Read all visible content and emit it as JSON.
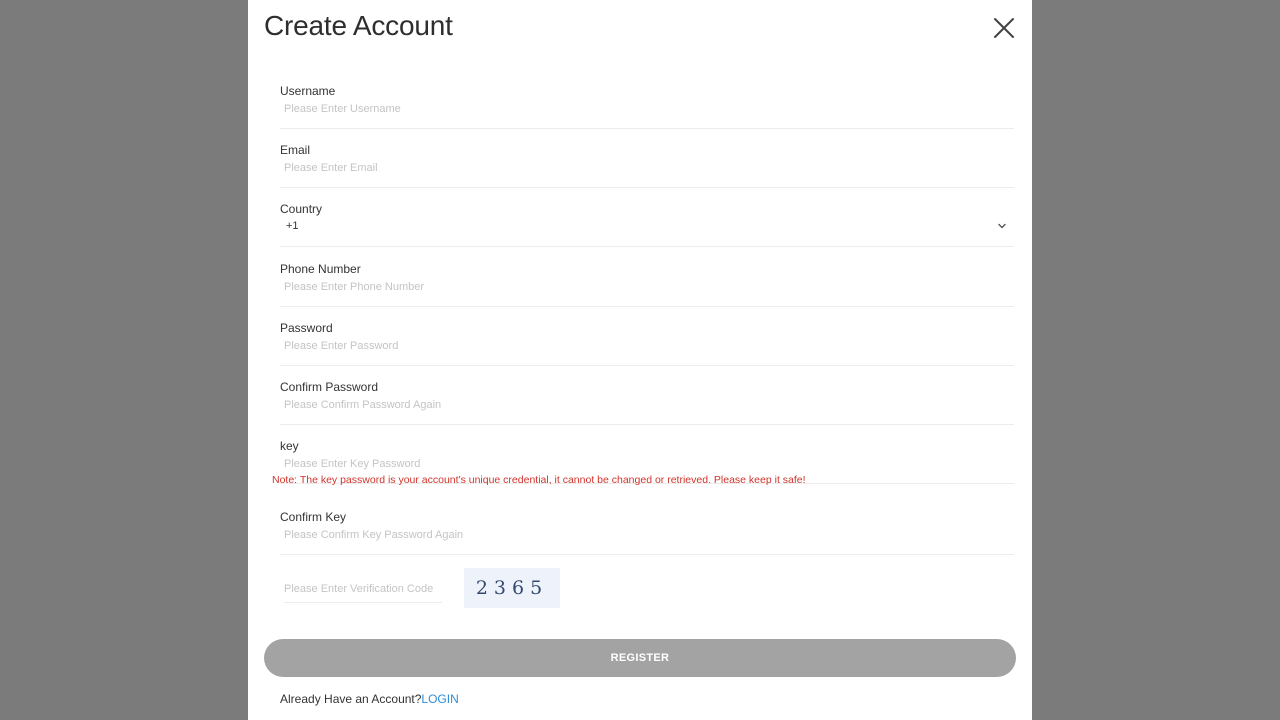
{
  "modal": {
    "title": "Create Account"
  },
  "fields": {
    "username": {
      "label": "Username",
      "placeholder": "Please Enter Username"
    },
    "email": {
      "label": "Email",
      "placeholder": "Please Enter Email"
    },
    "country": {
      "label": "Country",
      "value": "+1"
    },
    "phone": {
      "label": "Phone Number",
      "placeholder": "Please Enter Phone Number"
    },
    "password": {
      "label": "Password",
      "placeholder": "Please Enter Password"
    },
    "confirm_password": {
      "label": "Confirm Password",
      "placeholder": "Please Confirm Password Again"
    },
    "key": {
      "label": "key",
      "placeholder": "Please Enter Key Password"
    },
    "confirm_key": {
      "label": "Confirm Key",
      "placeholder": "Please Confirm Key Password Again"
    }
  },
  "note": "Note: The key password is your account's unique credential, it cannot be changed or retrieved. Please keep it safe!",
  "verification": {
    "placeholder": "Please Enter Verification Code",
    "captcha": "2365"
  },
  "register_label": "REGISTER",
  "login_prompt": {
    "text": "Already Have an Account?",
    "link": "LOGIN"
  },
  "icons": {
    "close": "close-icon",
    "chevron": "chevron-down-icon"
  },
  "colors": {
    "overlay": "#7b7b7b",
    "note": "#d0342c",
    "link": "#2d8dd6",
    "button": "#a3a3a3"
  }
}
